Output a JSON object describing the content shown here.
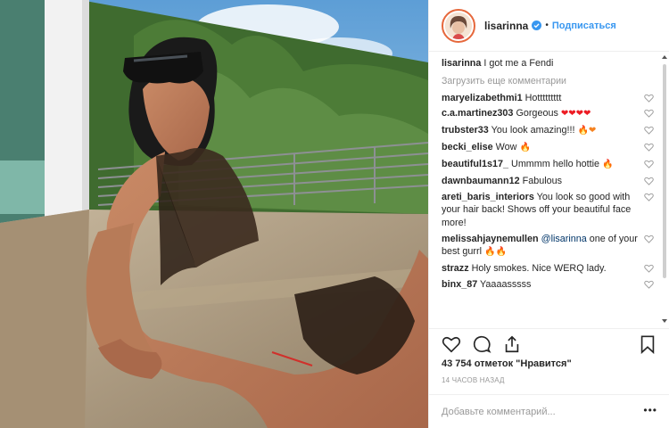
{
  "header": {
    "username": "lisarinna",
    "separator": "•",
    "follow_label": "Подписаться"
  },
  "caption": {
    "username": "lisarinna",
    "text": "I got me a Fendi"
  },
  "load_more": "Загрузить еще комментарии",
  "comments": [
    {
      "username": "maryelizabethmi1",
      "text": "Hottttttttt",
      "emoji": ""
    },
    {
      "username": "c.a.martinez303",
      "text": "Gorgeous",
      "emoji": "❤❤❤❤"
    },
    {
      "username": "trubster33",
      "text": "You look amazing!!!",
      "emoji": "🔥❤"
    },
    {
      "username": "becki_elise",
      "text": "Wow",
      "emoji": "🔥"
    },
    {
      "username": "beautiful1s17_",
      "text": "Ummmm hello hottie",
      "emoji": "🔥"
    },
    {
      "username": "dawnbaumann12",
      "text": "Fabulous",
      "emoji": ""
    },
    {
      "username": "areti_baris_interiors",
      "text": "You look so good with your hair back! Shows off your beautiful face more!",
      "emoji": ""
    },
    {
      "username": "melissahjaynemullen",
      "mention": "@lisarinna",
      "text": "one of your best gurrl",
      "emoji": "🔥🔥"
    },
    {
      "username": "strazz",
      "text": "Holy smokes. Nice WERQ lady.",
      "emoji": ""
    },
    {
      "username": "binx_87",
      "text": "Yaaaasssss",
      "emoji": ""
    }
  ],
  "likes": "43 754 отметок \"Нравится\"",
  "timestamp": "14 ЧАСОВ НАЗАД",
  "add_comment_placeholder": "Добавьте комментарий...",
  "more_label": "•••",
  "icons": {
    "like": "heart-icon",
    "comment": "comment-icon",
    "share": "share-icon",
    "save": "bookmark-icon",
    "verified": "verified-badge-icon"
  },
  "colors": {
    "accent": "#3897f0",
    "muted": "#999999",
    "text": "#262626",
    "emoji_red": "#ed1c24",
    "emoji_fire": "#f58220"
  }
}
